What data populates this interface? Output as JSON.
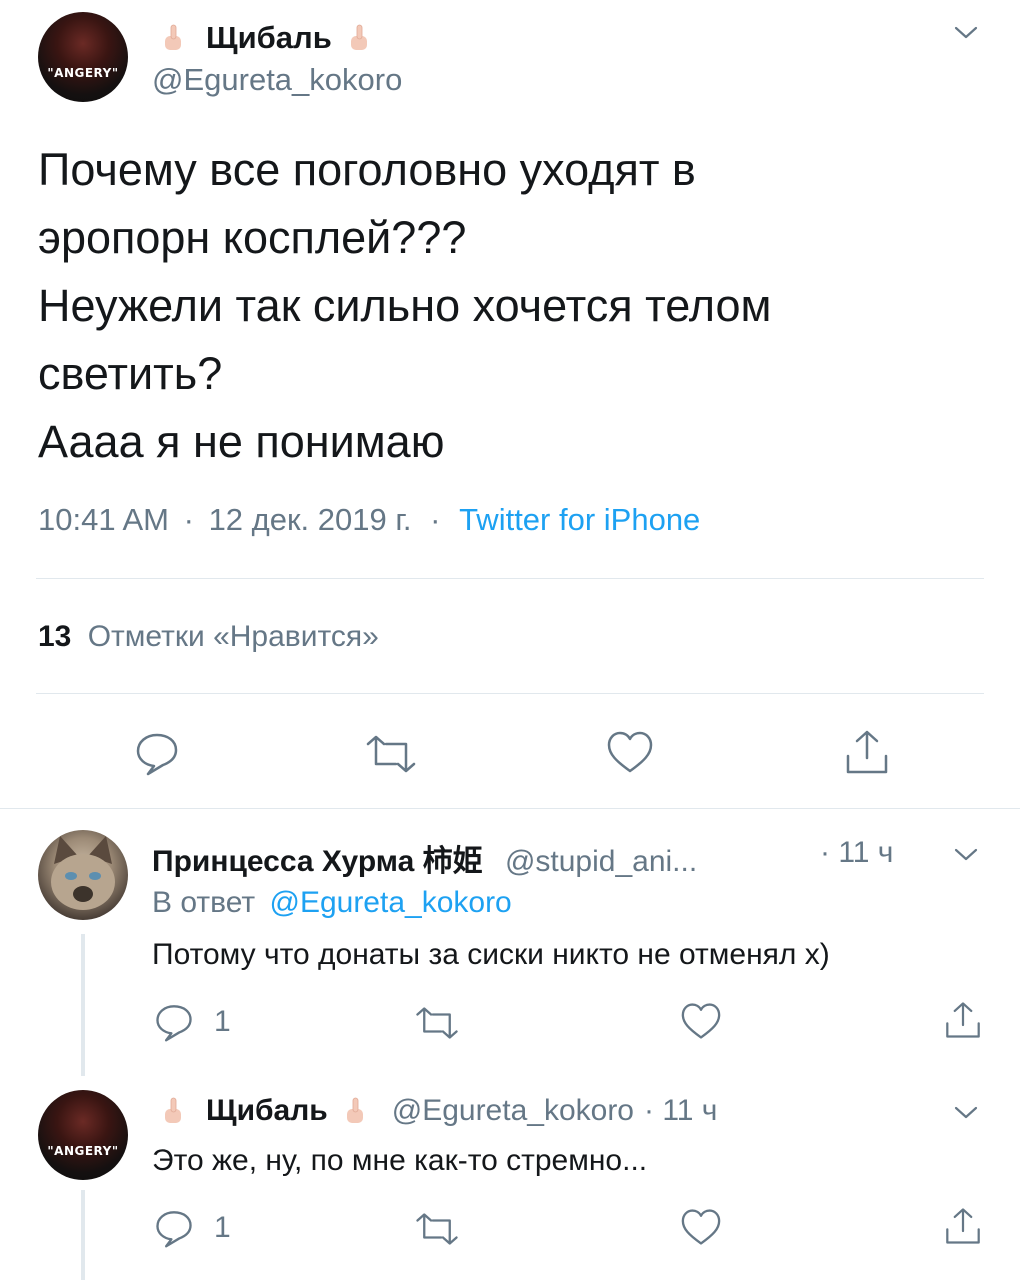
{
  "main_tweet": {
    "display_name": "Щибаль",
    "handle": "@Egureta_kokoro",
    "avatar_caption": "\"ANGERY\"",
    "text_lines": [
      "Почему все поголовно уходят в",
      "эропорн косплей???",
      "Неужели так сильно хочется телом",
      "светить?",
      "Аааа я не понимаю"
    ],
    "time": "10:41 AM",
    "date": "12 дек. 2019 г.",
    "separator": "·",
    "source": "Twitter for iPhone",
    "likes_count": "13",
    "likes_label": "Отметки «Нравится»"
  },
  "replies": [
    {
      "display_name": "Принцесса Хурма 柿姫",
      "handle": "@stupid_ani...",
      "time": "· 11 ч",
      "reply_to_prefix": "В ответ",
      "reply_to_handle": "@Egureta_kokoro",
      "text": "Потому что донаты за сиски никто не отменял х)",
      "reply_count": "1"
    },
    {
      "display_name": "Щибаль",
      "handle": "@Egureta_kokoro",
      "time": "· 11 ч",
      "avatar_caption": "\"ANGERY\"",
      "text": "Это же, ну, по мне как-то стремно...",
      "reply_count": "1"
    }
  ],
  "colors": {
    "accent": "#1da1f2",
    "secondary_text": "#657786",
    "divider": "#e1e8ed",
    "icon": "#657786"
  },
  "icons": [
    "chevron-down-icon",
    "reply-icon",
    "retweet-icon",
    "like-icon",
    "share-icon",
    "middle-finger-emoji"
  ]
}
